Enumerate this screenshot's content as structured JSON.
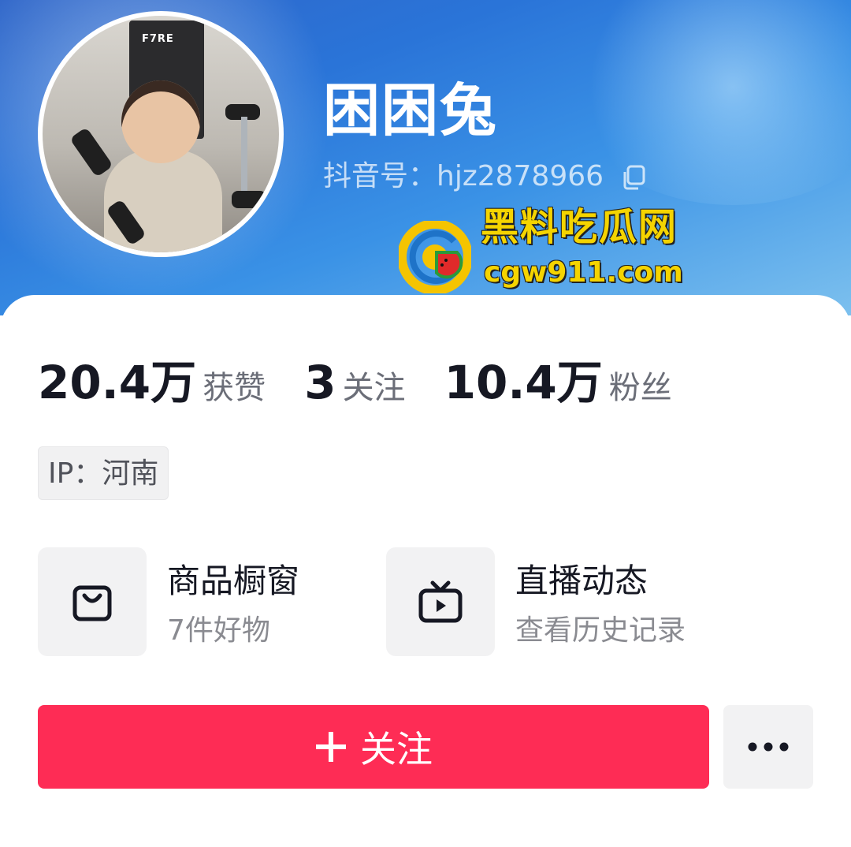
{
  "profile": {
    "nickname": "困困兔",
    "douyin_id": "抖音号：hjz2878966",
    "ip": "IP：河南"
  },
  "avatar": {
    "image_text": "F7RE"
  },
  "watermark": {
    "title": "黑料吃瓜网",
    "url": "cgw911.com"
  },
  "stats": [
    {
      "value": "20.4万",
      "label": "获赞"
    },
    {
      "value": "3",
      "label": "关注"
    },
    {
      "value": "10.4万",
      "label": "粉丝"
    }
  ],
  "features": [
    {
      "title": "商品橱窗",
      "subtitle": "7件好物",
      "icon": "shopping-bag-icon"
    },
    {
      "title": "直播动态",
      "subtitle": "查看历史记录",
      "icon": "tv-play-icon"
    }
  ],
  "actions": {
    "follow_label": "关注",
    "more_icon": "more-dots-icon"
  },
  "colors": {
    "accent": "#fe2c55",
    "header_blue": "#2a74d8",
    "watermark_yellow": "#f5d400"
  }
}
